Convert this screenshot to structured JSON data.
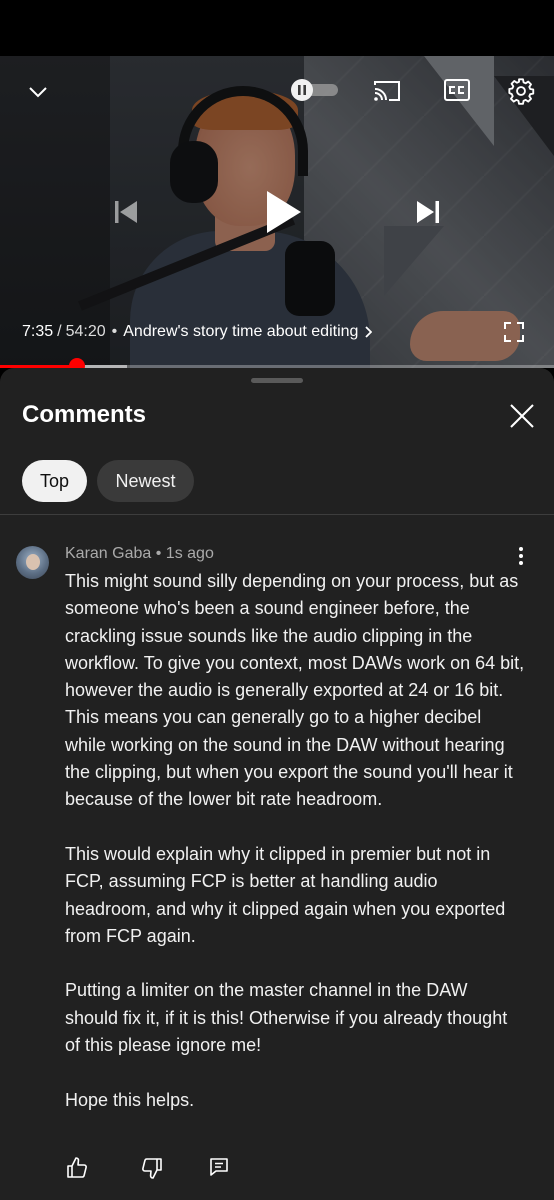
{
  "player": {
    "current_time": "7:35",
    "separator": "/",
    "total_time": "54:20",
    "chapter_dot": "•",
    "chapter_title": "Andrew's story time about editing",
    "progress_fraction": 0.139,
    "buffered_fraction": 0.23
  },
  "icons": {
    "collapse": "chevron-down-icon",
    "autoplay": "autoplay-toggle-icon",
    "cast": "cast-icon",
    "captions": "cc-icon",
    "settings": "gear-icon",
    "previous": "skip-previous-icon",
    "play": "play-icon",
    "next": "skip-next-icon",
    "fullscreen": "fullscreen-icon",
    "close": "close-icon",
    "more": "more-vert-icon",
    "like": "thumbs-up-icon",
    "dislike": "thumbs-down-icon",
    "reply": "reply-icon"
  },
  "comments_panel": {
    "title": "Comments",
    "chips": [
      {
        "label": "Top",
        "selected": true
      },
      {
        "label": "Newest",
        "selected": false
      }
    ]
  },
  "comment": {
    "author": "Karan Gaba",
    "dot": "•",
    "time": "1s ago",
    "paragraphs": [
      "This might sound silly depending on your process, but as someone who's been a sound engineer before, the crackling issue sounds like the audio clipping in the workflow. To give you context, most DAWs work on 64 bit, however the audio is generally exported at 24 or 16 bit. This means you can generally go to a higher decibel while working on the sound in the DAW without hearing the clipping, but when you export the sound you'll hear it because of the lower bit rate headroom.",
      "This would explain why it clipped in premier but not in FCP, assuming FCP is better at handling audio headroom, and why it clipped again when you exported from FCP again.",
      "Putting a limiter on the master channel in the DAW should fix it, if it is this! Otherwise if you already thought of this please ignore me!",
      "Hope this helps."
    ]
  },
  "colors": {
    "accent_red": "#ff0000",
    "sheet_background": "#212121",
    "chip_selected": "#f1f1f1",
    "chip_unselected": "#3a3a3a",
    "meta_text": "#aaaaaa"
  }
}
